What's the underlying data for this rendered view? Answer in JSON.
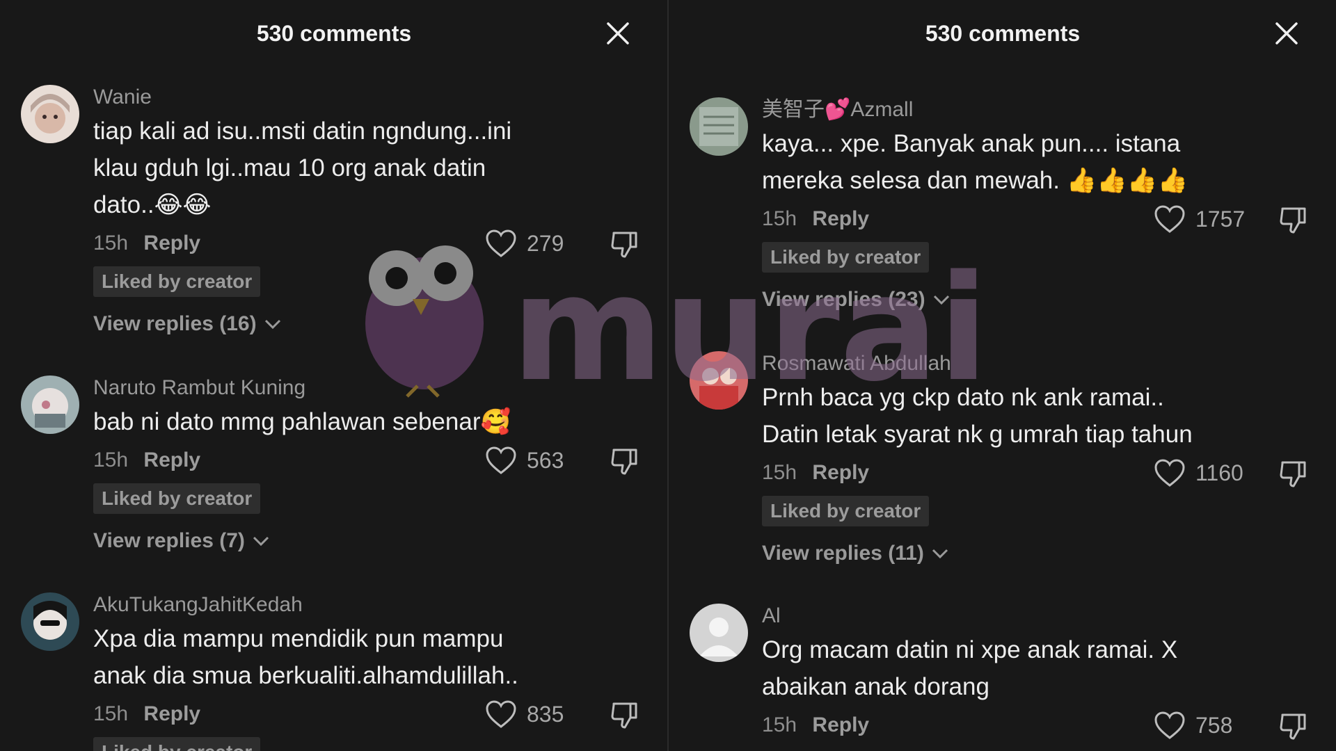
{
  "panels": [
    {
      "header": {
        "title": "530 comments"
      },
      "comments": [
        {
          "username": "Wanie",
          "lines": [
            "tiap kali ad isu..msti datin ngndung...ini",
            "klau gduh lgi..mau 10 org anak datin",
            "dato..😂😂"
          ],
          "time": "15h",
          "reply": "Reply",
          "likes": "279",
          "badge": "Liked by creator",
          "view_replies": "View replies (16)",
          "avatar_color": "#d8b8a8"
        },
        {
          "username": "Naruto Rambut Kuning",
          "lines": [
            "bab ni dato mmg pahlawan sebenar🥰"
          ],
          "time": "15h",
          "reply": "Reply",
          "likes": "563",
          "badge": "Liked by creator",
          "view_replies": "View replies (7)",
          "avatar_color": "#b9c7c9"
        },
        {
          "username": "AkuTukangJahitKedah",
          "lines": [
            "Xpa dia mampu mendidik pun mampu",
            "anak dia smua berkualiti.alhamdulillah.."
          ],
          "time": "15h",
          "reply": "Reply",
          "likes": "835",
          "badge": "Liked by creator",
          "view_replies": "",
          "avatar_color": "#2e4a55"
        }
      ]
    },
    {
      "header": {
        "title": "530 comments"
      },
      "comments": [
        {
          "username": "美智子💕Azmall",
          "lines": [
            "kaya... xpe. Banyak anak pun.... istana",
            "mereka selesa dan mewah. 👍👍👍👍"
          ],
          "time": "15h",
          "reply": "Reply",
          "likes": "1757",
          "badge": "Liked by creator",
          "view_replies": "View replies (23)",
          "avatar_color": "#8a9a8c"
        },
        {
          "username": "Rosmawati Abdullah",
          "lines": [
            "Prnh baca yg ckp dato nk ank ramai..",
            "Datin letak syarat nk g umrah tiap tahun"
          ],
          "time": "15h",
          "reply": "Reply",
          "likes": "1160",
          "badge": "Liked by creator",
          "view_replies": "View replies (11)",
          "avatar_color": "#c84a4a"
        },
        {
          "username": "Al",
          "lines": [
            "Org macam datin ni xpe anak ramai. X",
            "abaikan anak dorang"
          ],
          "time": "15h",
          "reply": "Reply",
          "likes": "758",
          "badge": "",
          "view_replies": "",
          "avatar_color": "#cfcfcf"
        }
      ]
    }
  ],
  "watermark": {
    "text": "murai",
    "color": "#8a6a8e"
  }
}
